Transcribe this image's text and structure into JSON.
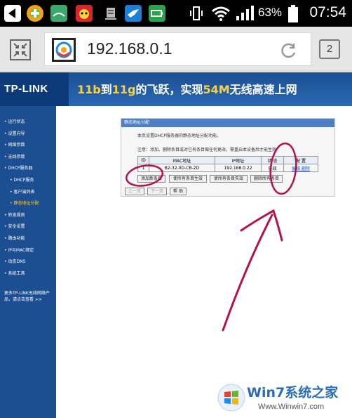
{
  "status_bar": {
    "battery_percent": "63%",
    "time": "07:54",
    "icons": [
      "back-icon",
      "game-icon",
      "reading-icon",
      "cat-icon",
      "server-icon",
      "bird-icon",
      "battery-app-icon",
      "vibrate-icon",
      "wifi-icon",
      "signal-icon",
      "battery-icon"
    ]
  },
  "browser": {
    "url": "192.168.0.1",
    "tab_count": "2"
  },
  "router": {
    "logo": "TP-LINK",
    "slogan_parts": [
      "11b",
      "到",
      "11g",
      "的飞跃，实现",
      "54M",
      "无线高速上网"
    ]
  },
  "sidebar": {
    "items": [
      {
        "label": "• 运行状态",
        "sub": false,
        "active": false
      },
      {
        "label": "• 设置向导",
        "sub": false,
        "active": false
      },
      {
        "label": "• 网络参数",
        "sub": false,
        "active": false
      },
      {
        "label": "• 无线参数",
        "sub": false,
        "active": false
      },
      {
        "label": "• DHCP服务器",
        "sub": false,
        "active": false
      },
      {
        "label": "• DHCP服务",
        "sub": true,
        "active": false
      },
      {
        "label": "• 客户端列表",
        "sub": true,
        "active": false
      },
      {
        "label": "• 静态地址分配",
        "sub": true,
        "active": true
      },
      {
        "label": "• 转发规则",
        "sub": false,
        "active": false
      },
      {
        "label": "• 安全设置",
        "sub": false,
        "active": false
      },
      {
        "label": "• 路由功能",
        "sub": false,
        "active": false
      },
      {
        "label": "• IP与MAC绑定",
        "sub": false,
        "active": false
      },
      {
        "label": "• 动态DNS",
        "sub": false,
        "active": false
      },
      {
        "label": "• 系统工具",
        "sub": false,
        "active": false
      }
    ],
    "more_text": "更多TP-LINK无线网络产品，请点击查看 >>"
  },
  "panel": {
    "title": "静态地址分配",
    "desc": "本页设置DHCP服务器的静态地址分配功能。",
    "note": "注意：添加、删除条目或对已有条目做任何更改，需重启本设备后才能生效",
    "table": {
      "headers": [
        "ID",
        "MAC地址",
        "IP地址",
        "状 态",
        "配 置"
      ],
      "rows": [
        [
          "1",
          "B2-32-0D-CB-2D",
          "192.168.0.22",
          "失效",
          "编辑 删除"
        ]
      ]
    },
    "buttons": [
      "添加新条目",
      "使所有条目生效",
      "使所有条目失效",
      "删除所有条目"
    ],
    "nav_buttons": [
      "上一页",
      "下一页",
      "帮 助"
    ]
  },
  "watermark": {
    "name": "Win7系统之家",
    "url": "Www.Winwin7.com"
  },
  "colors": {
    "status_bg": "#000000",
    "router_header": "#1c4f92",
    "panel_title": "#4d7fc4",
    "annotation": "#b2124d",
    "link": "#1a55cc"
  }
}
